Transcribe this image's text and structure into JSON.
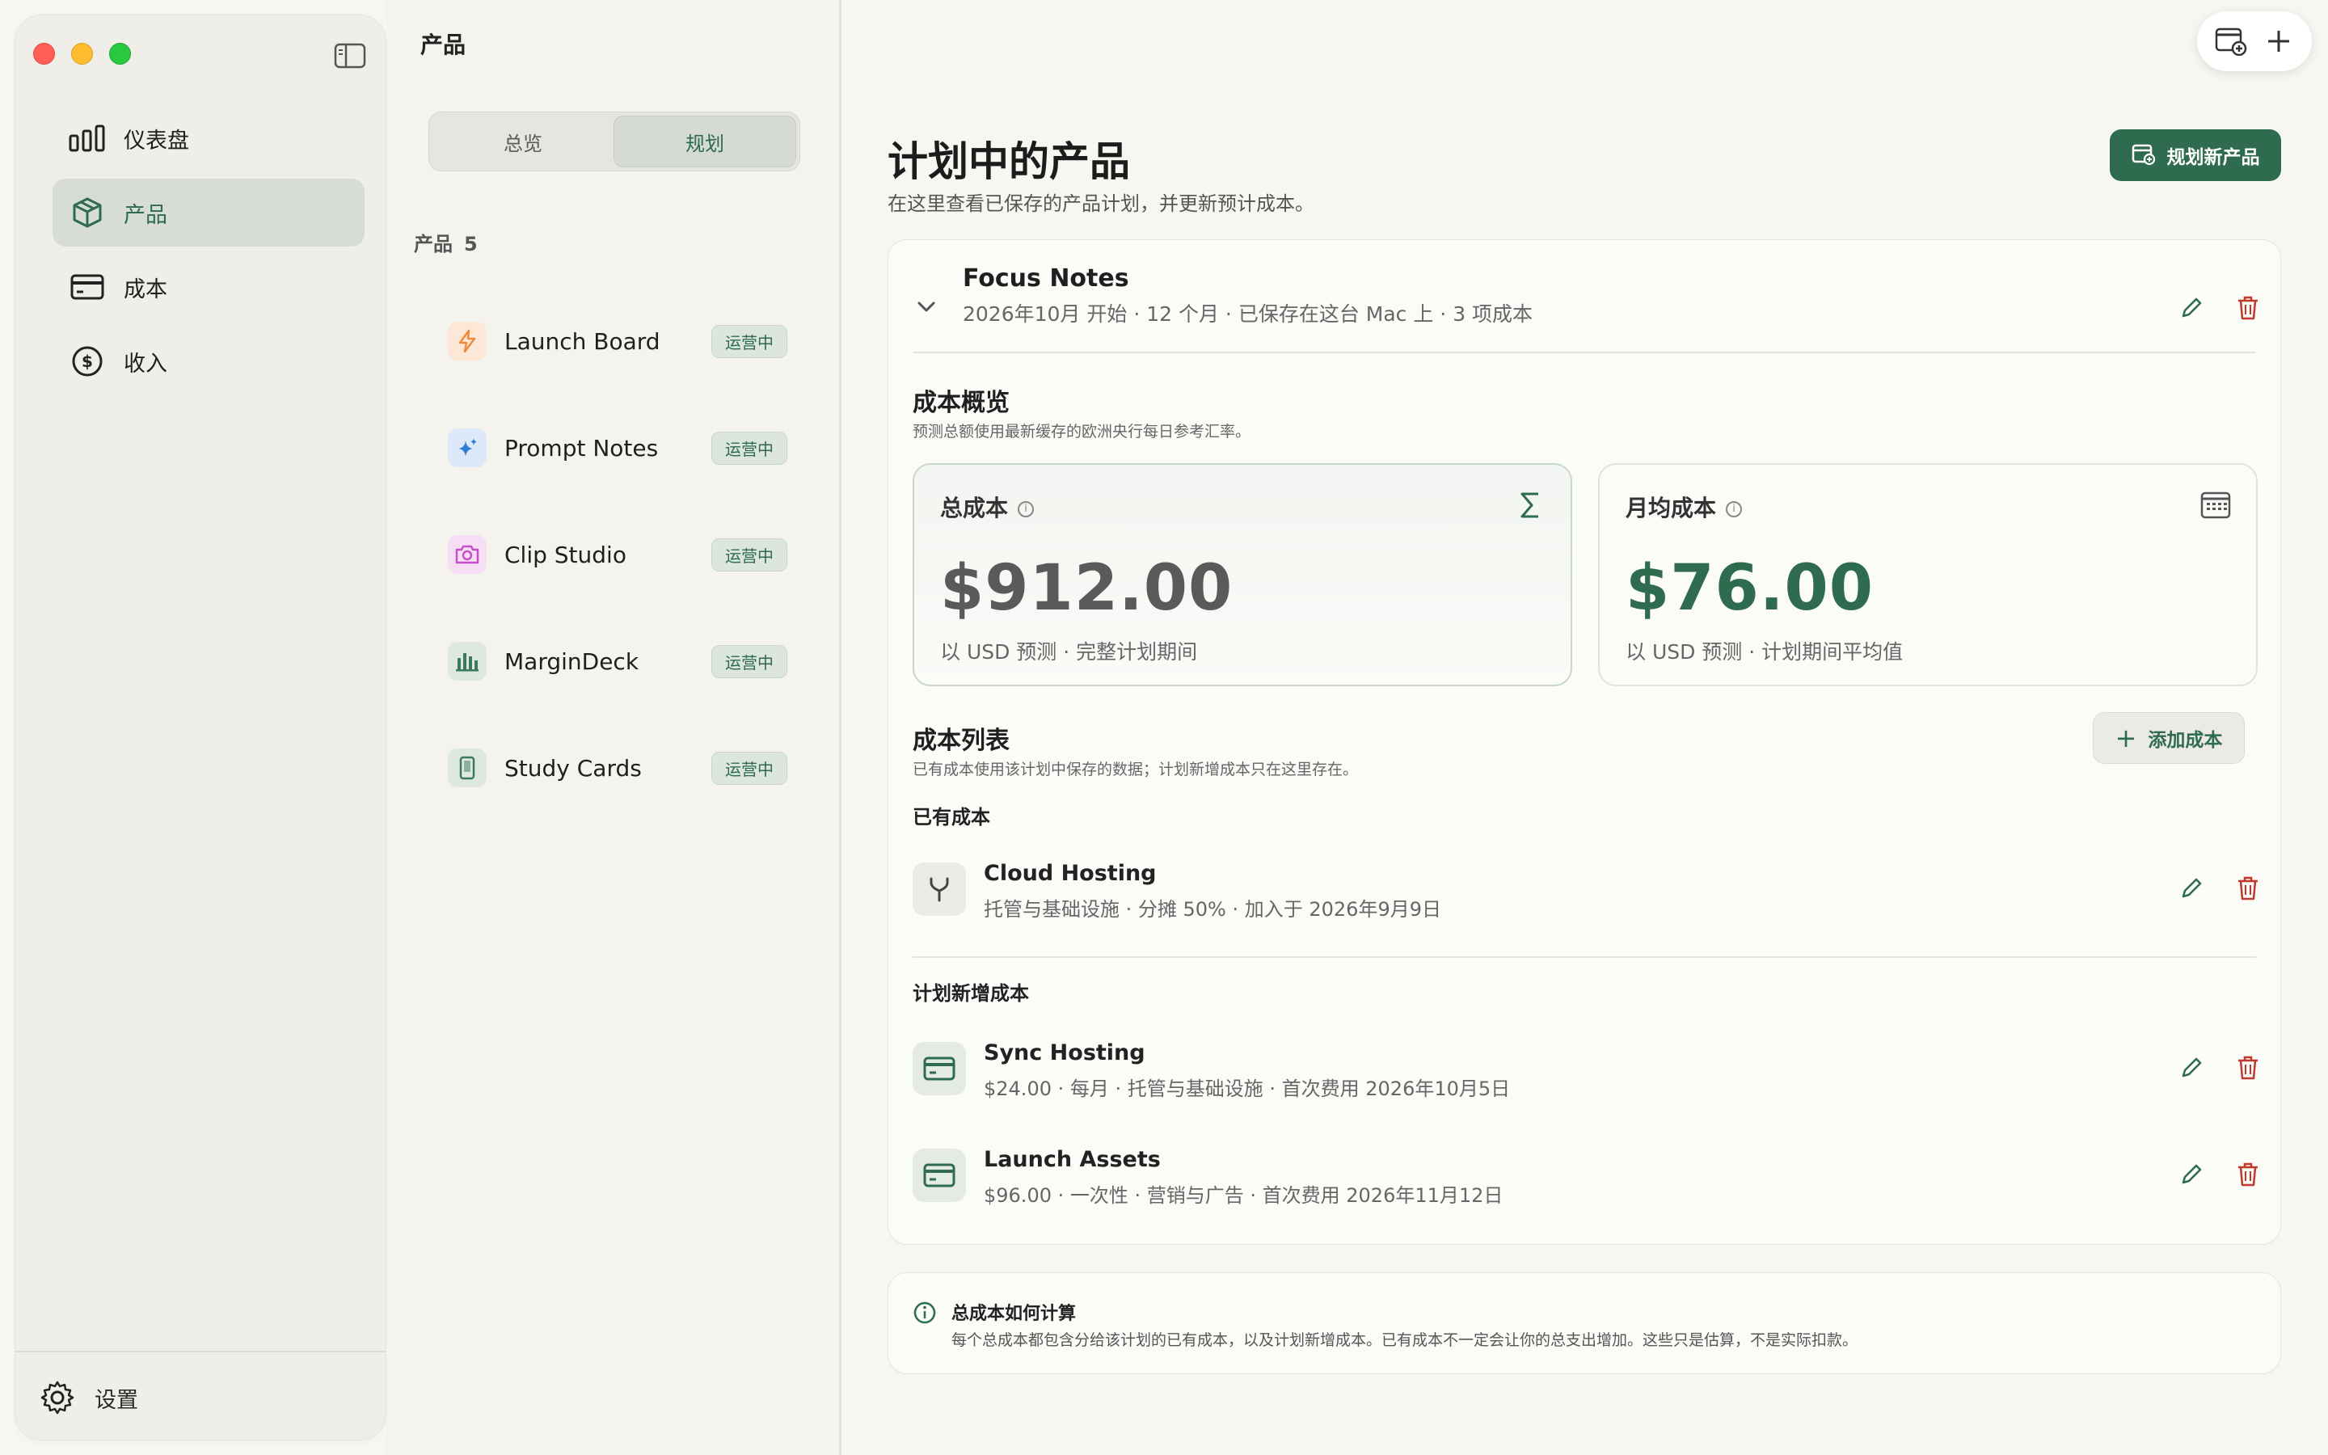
{
  "sidebar": {
    "items": [
      {
        "label": "仪表盘",
        "icon": "bar-chart-icon"
      },
      {
        "label": "产品",
        "icon": "box-icon",
        "active": true
      },
      {
        "label": "成本",
        "icon": "credit-card-icon"
      },
      {
        "label": "收入",
        "icon": "dollar-circle-icon"
      }
    ],
    "settings_label": "设置"
  },
  "product_list": {
    "title": "产品",
    "tabs": [
      "总览",
      "规划"
    ],
    "active_tab": "规划",
    "count_label": "产品",
    "count": "5",
    "items": [
      {
        "name": "Launch Board",
        "status": "运营中",
        "icon": "lightning-icon",
        "color": "#f08a3c"
      },
      {
        "name": "Prompt Notes",
        "status": "运营中",
        "icon": "sparkle-icon",
        "color": "#2f7fd8"
      },
      {
        "name": "Clip Studio",
        "status": "运营中",
        "icon": "camera-icon",
        "color": "#c64fc9"
      },
      {
        "name": "MarginDeck",
        "status": "运营中",
        "icon": "bars-icon",
        "color": "#3b7a5c"
      },
      {
        "name": "Study Cards",
        "status": "运营中",
        "icon": "phone-icon",
        "color": "#3b7a5c"
      }
    ]
  },
  "main": {
    "title": "计划中的产品",
    "subtitle": "在这里查看已保存的产品计划，并更新预计成本。",
    "primary_button": "规划新产品",
    "plan": {
      "name": "Focus Notes",
      "meta": "2026年10月 开始 · 12 个月 · 已保存在这台 Mac 上  ·  3 项成本"
    },
    "overview": {
      "title": "成本概览",
      "subtitle": "预测总额使用最新缓存的欧洲央行每日参考汇率。",
      "total": {
        "label": "总成本",
        "value": "$912.00",
        "desc": "以 USD 预测 · 完整计划期间"
      },
      "monthly": {
        "label": "月均成本",
        "value": "$76.00",
        "desc": "以 USD 预测 · 计划期间平均值"
      }
    },
    "cost_list": {
      "title": "成本列表",
      "subtitle": "已有成本使用该计划中保存的数据；计划新增成本只在这里存在。",
      "add_button": "添加成本",
      "existing_label": "已有成本",
      "existing": [
        {
          "name": "Cloud Hosting",
          "meta": "托管与基础设施 · 分摊 50% · 加入于 2026年9月9日",
          "icon": "fork-icon"
        }
      ],
      "planned_label": "计划新增成本",
      "planned": [
        {
          "name": "Sync Hosting",
          "meta": "$24.00 · 每月 · 托管与基础设施 · 首次费用 2026年10月5日",
          "icon": "card-icon"
        },
        {
          "name": "Launch Assets",
          "meta": "$96.00 · 一次性 · 营销与广告 · 首次费用 2026年11月12日",
          "icon": "card-icon"
        }
      ]
    },
    "note": {
      "title": "总成本如何计算",
      "text": "每个总成本都包含分给该计划的已有成本，以及计划新增成本。已有成本不一定会让你的总支出增加。这些只是估算，不是实际扣款。"
    }
  },
  "colors": {
    "accent": "#2e6b4f",
    "danger": "#c0392b"
  }
}
